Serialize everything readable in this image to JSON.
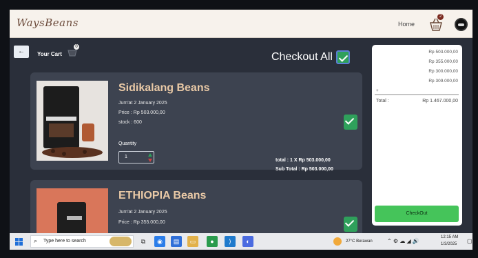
{
  "navbar": {
    "logo": "WaysBeans",
    "home_label": "Home",
    "basket_count": "2"
  },
  "cart": {
    "back_label": "←",
    "title": "Your Cart",
    "badge": "0",
    "checkout_all_label": "Checkout All",
    "items": [
      {
        "name": "Sidikalang Beans",
        "date": "Jum'at 2 January 2025",
        "price": "Price : Rp 503.000,00",
        "stock": "stock : 600",
        "quantity_label": "Quantity",
        "quantity": "1",
        "line_total": "total : 1 X Rp 503.000,00",
        "sub_total": "Sub Total : Rp 503.000,00"
      },
      {
        "name": "ETHIOPIA Beans",
        "date": "Jum'at 2 January 2025",
        "price": "Price : Rp 355.000,00"
      }
    ]
  },
  "summary": {
    "prices": [
      "Rp 503.000,00",
      "Rp 355.000,00",
      "Rp 300.000,00",
      "Rp 309.000,00"
    ],
    "plus": "+",
    "total_label": "Total :",
    "total_value": "Rp 1.467.000,00",
    "checkout_label": "CheckOut"
  },
  "taskbar": {
    "search_placeholder": "Type here to search",
    "weather": "27°C Berawan",
    "time": "12:15 AM",
    "date": "1/3/2025"
  },
  "colors": {
    "card_bg": "#3d4350",
    "accent_green": "#45c45a",
    "product_name": "#e9c9a6"
  }
}
